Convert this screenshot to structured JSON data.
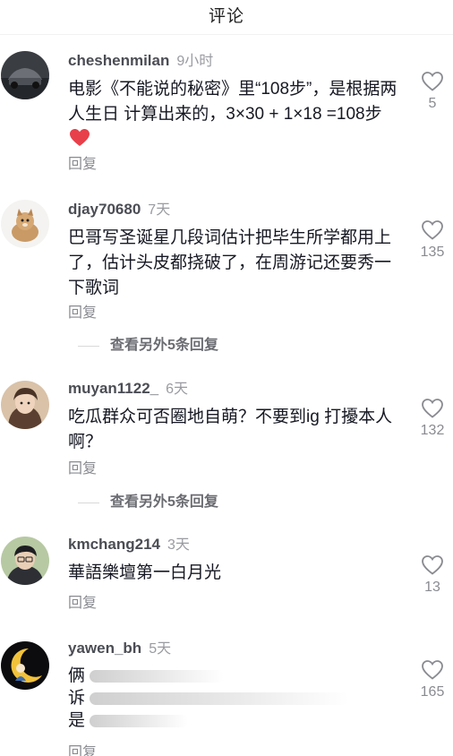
{
  "header": {
    "title": "评论"
  },
  "comments": [
    {
      "username": "cheshenmilan",
      "time": "9小时",
      "text_main": "电影《不能说的秘密》里“108步”，是根据两人生日 计算出来的，3×30 + 1×18 =108步",
      "emoji": "heart",
      "reply_label": "回复",
      "likes": "5"
    },
    {
      "username": "djay70680",
      "time": "7天",
      "text_main": "巴哥写圣诞星几段词估计把毕生所学都用上了，估计头皮都挠破了，在周游记还要秀一下歌词",
      "reply_label": "回复",
      "likes": "135"
    },
    {
      "username": "muyan1122_",
      "time": "6天",
      "text_main": "吃瓜群众可否圈地自萌？不要到ig 打擾本人啊？",
      "reply_label": "回复",
      "likes": "132"
    },
    {
      "username": "kmchang214",
      "time": "3天",
      "text_main": "華語樂壇第一白月光",
      "reply_label": "回复",
      "likes": "13"
    },
    {
      "username": "yawen_bh",
      "time": "5天",
      "text_lines": [
        "俩",
        "诉",
        "是"
      ],
      "reply_label": "回复",
      "likes": "165"
    }
  ],
  "more_replies": [
    {
      "label": "查看另外5条回复"
    },
    {
      "label": "查看另外5条回复"
    }
  ],
  "icons": {
    "like": "heart-outline-icon",
    "emoji": "red-heart-emoji"
  },
  "colors": {
    "username": "#4b4d55",
    "meta": "#9a9ba1",
    "text": "#161823",
    "emoji_heart": "#e8404a"
  }
}
